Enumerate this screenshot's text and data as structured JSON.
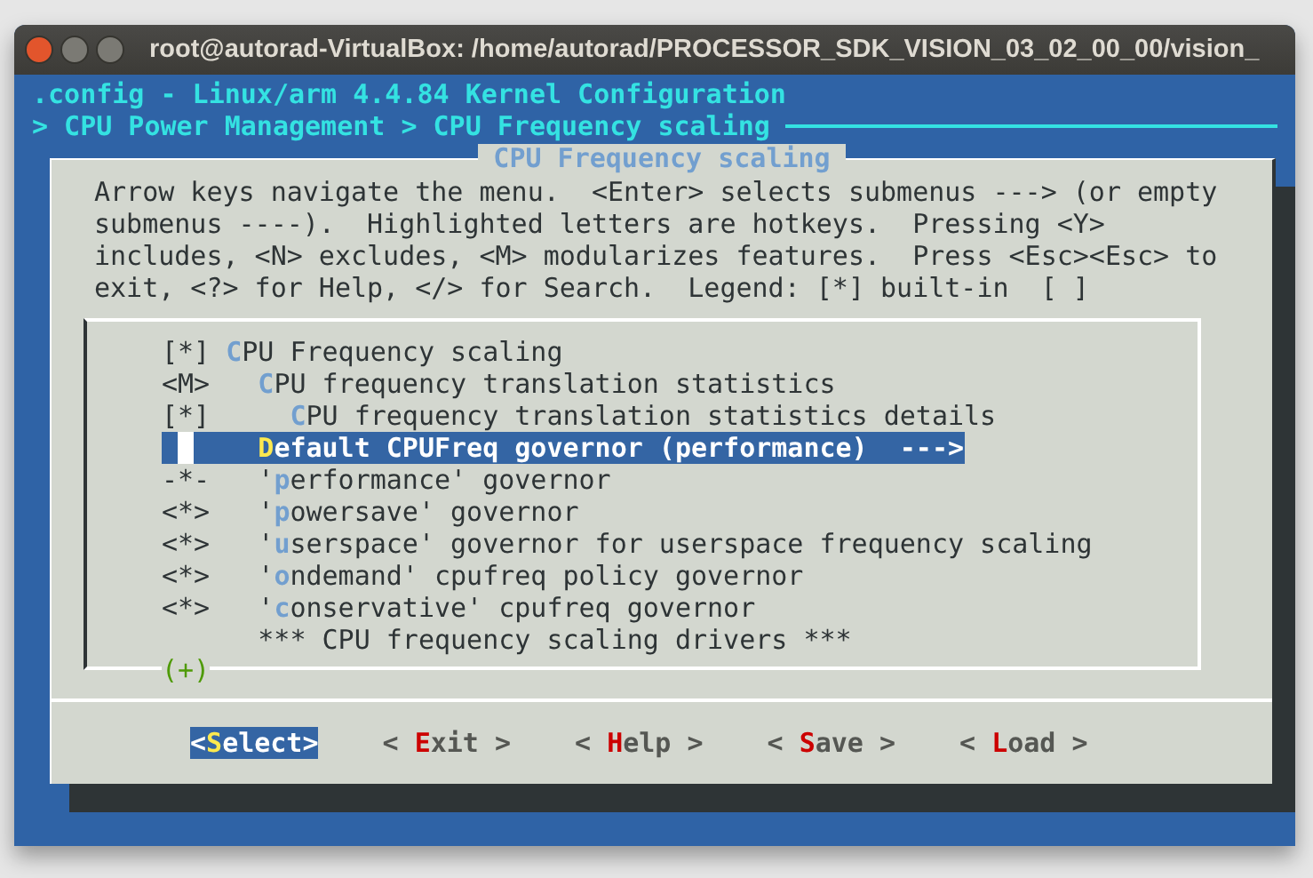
{
  "window": {
    "title": "root@autorad-VirtualBox: /home/autorad/PROCESSOR_SDK_VISION_03_02_00_00/vision_"
  },
  "header": {
    "title": ".config - Linux/arm 4.4.84 Kernel Configuration",
    "breadcrumb": "> CPU Power Management > CPU Frequency scaling"
  },
  "dialog": {
    "title": "CPU Frequency scaling",
    "help_lines": [
      "Arrow keys navigate the menu.  <Enter> selects submenus ---> (or empty",
      "submenus ----).  Highlighted letters are hotkeys.  Pressing <Y>",
      "includes, <N> excludes, <M> modularizes features.  Press <Esc><Esc> to",
      "exit, <?> for Help, </> for Search.  Legend: [*] built-in  [ ]"
    ],
    "menu": [
      {
        "prefix": "[*]",
        "hotkey": "C",
        "after": "PU Frequency scaling",
        "selected": false,
        "children": [
          {
            "prefix": "<M>",
            "hotkey": "C",
            "after": "PU frequency translation statistics",
            "selected": false,
            "children": [
              {
                "prefix": "[*]",
                "hotkey": "C",
                "after": "PU frequency translation statistics details",
                "selected": false
              }
            ]
          },
          {
            "hotkey": "D",
            "after": "efault CPUFreq governor (performance)  --->",
            "selected": true
          },
          {
            "prefix": "-*-",
            "before": "'",
            "hotkey": "p",
            "after": "erformance' governor",
            "selected": false
          },
          {
            "prefix": "<*>",
            "before": "'",
            "hotkey": "p",
            "after": "owersave' governor",
            "selected": false
          },
          {
            "prefix": "<*>",
            "before": "'",
            "hotkey": "u",
            "after": "serspace' governor for userspace frequency scaling",
            "selected": false
          },
          {
            "prefix": "<*>",
            "before": "'",
            "hotkey": "o",
            "after": "ndemand' cpufreq policy governor",
            "selected": false
          },
          {
            "prefix": "<*>",
            "before": "'",
            "hotkey": "c",
            "after": "onservative' cpufreq governor",
            "selected": false
          },
          {
            "before": "*** CPU frequency scaling drivers ***",
            "selected": false
          }
        ]
      }
    ],
    "more_indicator": "(+)",
    "buttons": [
      {
        "before": "<",
        "hotkey": "S",
        "after": "elect>",
        "selected": true
      },
      {
        "before": "< ",
        "hotkey": "E",
        "after": "xit >",
        "selected": false
      },
      {
        "before": "< ",
        "hotkey": "H",
        "after": "elp >",
        "selected": false
      },
      {
        "before": "< ",
        "hotkey": "S",
        "after": "ave >",
        "selected": false
      },
      {
        "before": "< ",
        "hotkey": "L",
        "after": "oad >",
        "selected": false
      }
    ]
  }
}
